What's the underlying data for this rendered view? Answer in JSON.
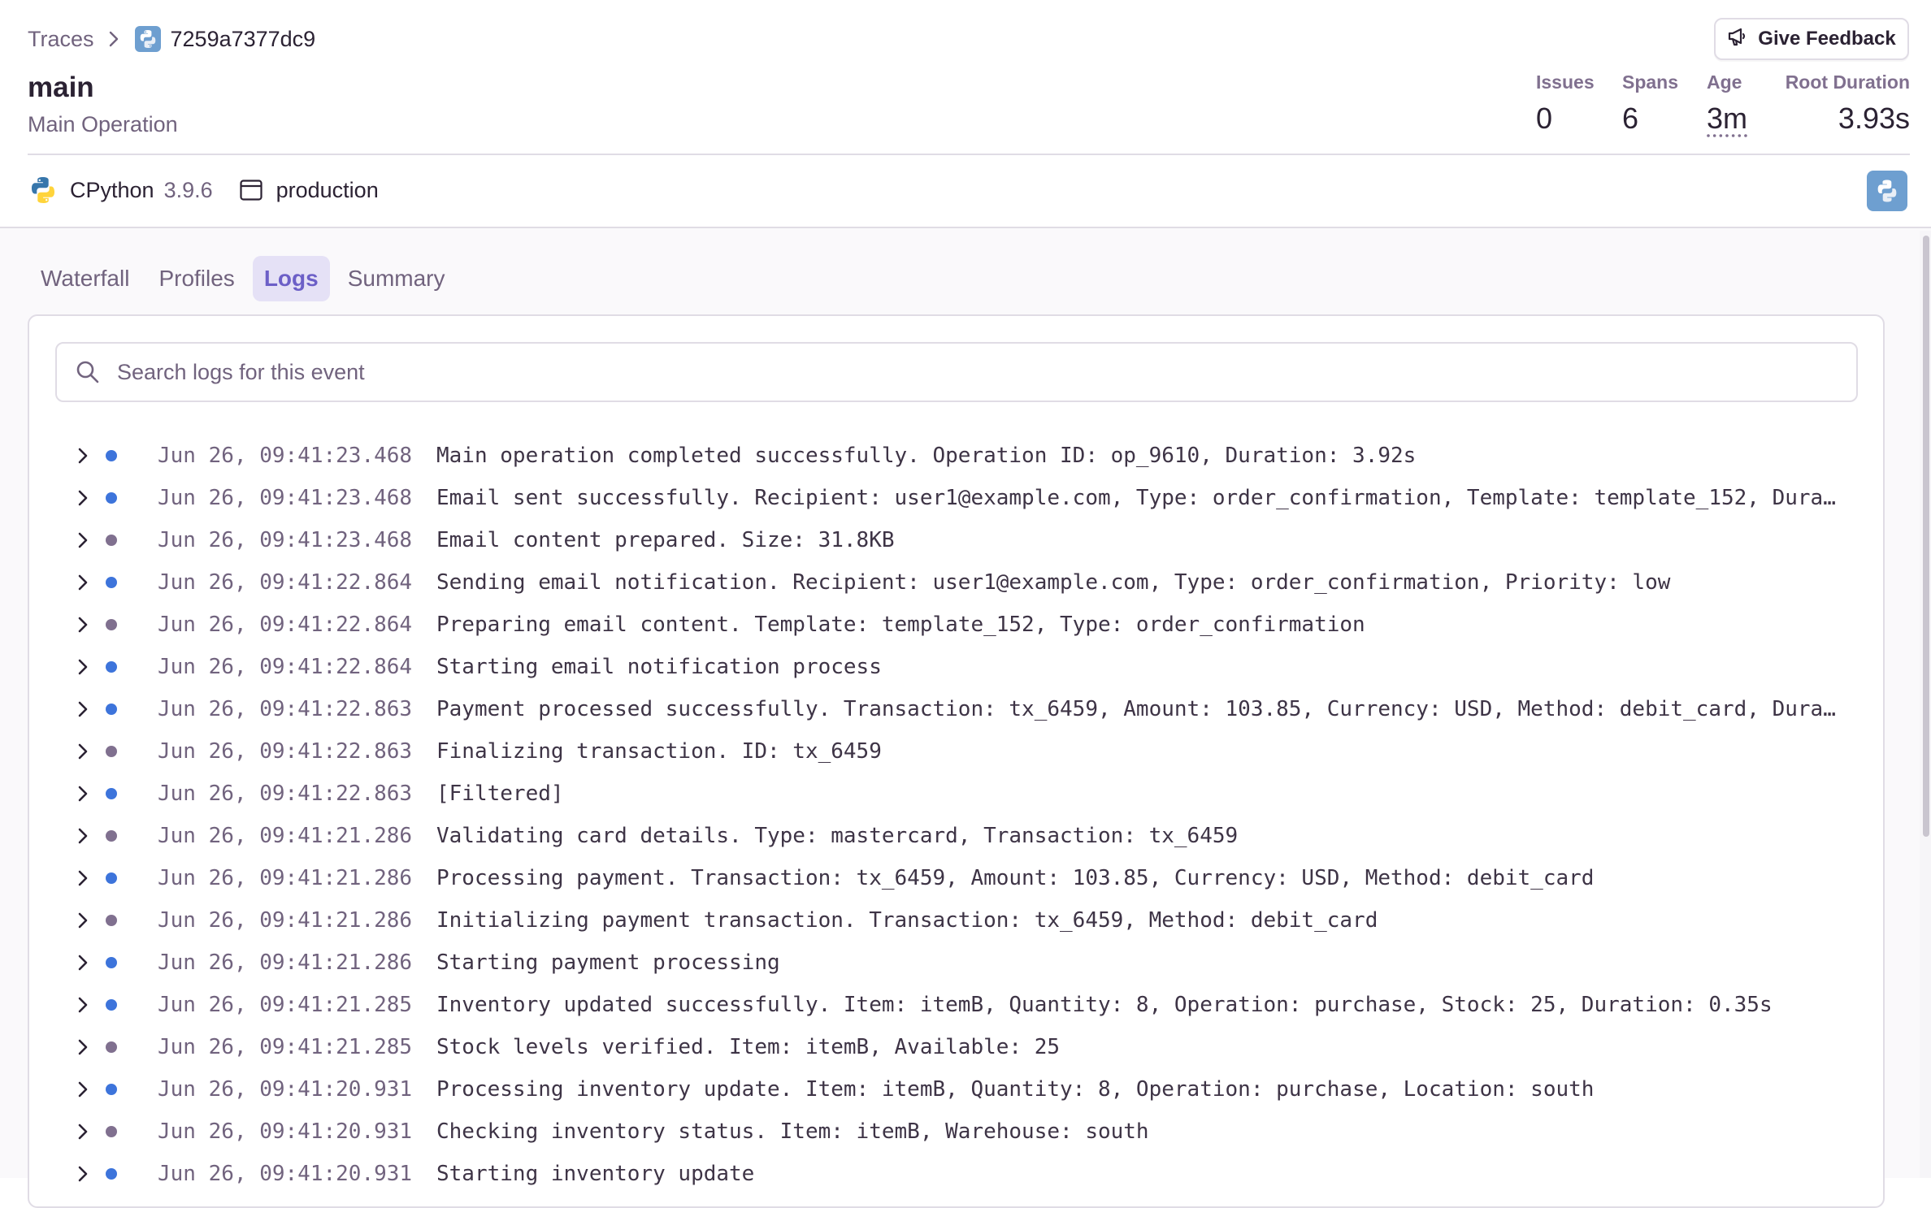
{
  "breadcrumb": {
    "parent": "Traces",
    "current": "7259a7377dc9",
    "platform_icon": "python-logo"
  },
  "header": {
    "title": "main",
    "subtitle": "Main Operation",
    "feedback_label": "Give Feedback",
    "feedback_icon": "megaphone-icon"
  },
  "stats": {
    "issues": {
      "label": "Issues",
      "value": "0"
    },
    "spans": {
      "label": "Spans",
      "value": "6"
    },
    "age": {
      "label": "Age",
      "value": "3m"
    },
    "root_duration": {
      "label": "Root Duration",
      "value": "3.93s"
    }
  },
  "context": {
    "runtime_name": "CPython",
    "runtime_version": "3.9.6",
    "environment": "production"
  },
  "tabs": [
    {
      "label": "Waterfall",
      "active": false
    },
    {
      "label": "Profiles",
      "active": false
    },
    {
      "label": "Logs",
      "active": true
    },
    {
      "label": "Summary",
      "active": false
    }
  ],
  "search": {
    "placeholder": "Search logs for this event",
    "value": ""
  },
  "colors": {
    "accent": "#6c5fc7",
    "info_dot": "#3d74db",
    "debug_dot": "#80708f",
    "python_blue": "#3776ab",
    "python_yellow": "#ffd43b"
  },
  "logs": [
    {
      "level": "info",
      "timestamp": "Jun 26, 09:41:23.468",
      "message": "Main operation completed successfully. Operation ID: op_9610, Duration: 3.92s"
    },
    {
      "level": "info",
      "timestamp": "Jun 26, 09:41:23.468",
      "message": "Email sent successfully. Recipient: user1@example.com, Type: order_confirmation, Template: template_152, Dura…"
    },
    {
      "level": "debug",
      "timestamp": "Jun 26, 09:41:23.468",
      "message": "Email content prepared. Size: 31.8KB"
    },
    {
      "level": "info",
      "timestamp": "Jun 26, 09:41:22.864",
      "message": "Sending email notification. Recipient: user1@example.com, Type: order_confirmation, Priority: low"
    },
    {
      "level": "debug",
      "timestamp": "Jun 26, 09:41:22.864",
      "message": "Preparing email content. Template: template_152, Type: order_confirmation"
    },
    {
      "level": "info",
      "timestamp": "Jun 26, 09:41:22.864",
      "message": "Starting email notification process"
    },
    {
      "level": "info",
      "timestamp": "Jun 26, 09:41:22.863",
      "message": "Payment processed successfully. Transaction: tx_6459, Amount: 103.85, Currency: USD, Method: debit_card, Dura…"
    },
    {
      "level": "debug",
      "timestamp": "Jun 26, 09:41:22.863",
      "message": "Finalizing transaction. ID: tx_6459"
    },
    {
      "level": "info",
      "timestamp": "Jun 26, 09:41:22.863",
      "message": "[Filtered]"
    },
    {
      "level": "debug",
      "timestamp": "Jun 26, 09:41:21.286",
      "message": "Validating card details. Type: mastercard, Transaction: tx_6459"
    },
    {
      "level": "info",
      "timestamp": "Jun 26, 09:41:21.286",
      "message": "Processing payment. Transaction: tx_6459, Amount: 103.85, Currency: USD, Method: debit_card"
    },
    {
      "level": "debug",
      "timestamp": "Jun 26, 09:41:21.286",
      "message": "Initializing payment transaction. Transaction: tx_6459, Method: debit_card"
    },
    {
      "level": "info",
      "timestamp": "Jun 26, 09:41:21.286",
      "message": "Starting payment processing"
    },
    {
      "level": "info",
      "timestamp": "Jun 26, 09:41:21.285",
      "message": "Inventory updated successfully. Item: itemB, Quantity: 8, Operation: purchase, Stock: 25, Duration: 0.35s"
    },
    {
      "level": "debug",
      "timestamp": "Jun 26, 09:41:21.285",
      "message": "Stock levels verified. Item: itemB, Available: 25"
    },
    {
      "level": "info",
      "timestamp": "Jun 26, 09:41:20.931",
      "message": "Processing inventory update. Item: itemB, Quantity: 8, Operation: purchase, Location: south"
    },
    {
      "level": "debug",
      "timestamp": "Jun 26, 09:41:20.931",
      "message": "Checking inventory status. Item: itemB, Warehouse: south"
    },
    {
      "level": "info",
      "timestamp": "Jun 26, 09:41:20.931",
      "message": "Starting inventory update"
    }
  ]
}
